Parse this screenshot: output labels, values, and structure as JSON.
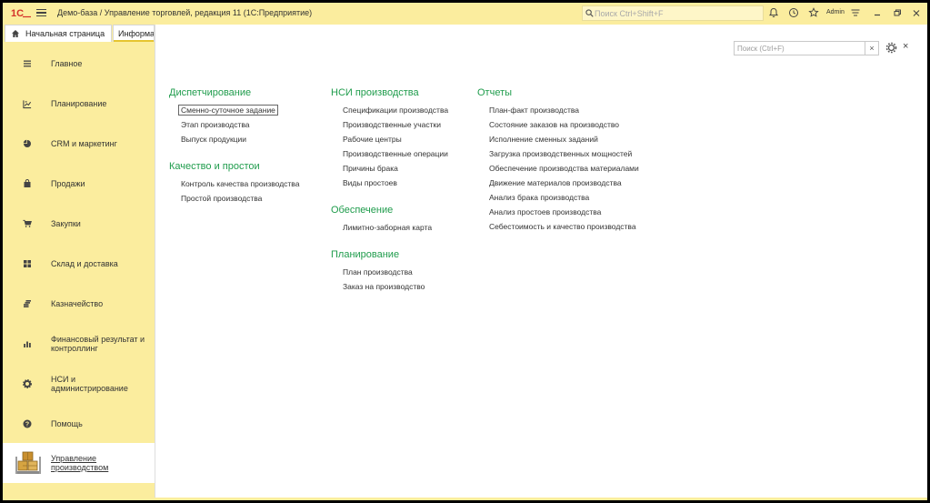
{
  "window": {
    "title": "Демо-база / Управление торговлей, редакция 11  (1С:Предприятие)",
    "search_placeholder": "Поиск Ctrl+Shift+F",
    "user": "Admin"
  },
  "tabs": [
    {
      "label": "Начальная страница"
    },
    {
      "label": "Информа"
    }
  ],
  "sidebar": {
    "items": [
      {
        "label": "Главное",
        "icon": "menu-lines-icon"
      },
      {
        "label": "Планирование",
        "icon": "planning-chart-icon"
      },
      {
        "label": "CRM и маркетинг",
        "icon": "pie-chart-icon"
      },
      {
        "label": "Продажи",
        "icon": "bag-icon"
      },
      {
        "label": "Закупки",
        "icon": "cart-icon"
      },
      {
        "label": "Склад и доставка",
        "icon": "warehouse-grid-icon"
      },
      {
        "label": "Казначейство",
        "icon": "coins-stack-icon"
      },
      {
        "label": "Финансовый результат и контроллинг",
        "icon": "bar-chart-icon"
      },
      {
        "label": "НСИ и администрирование",
        "icon": "gear-icon"
      },
      {
        "label": "Помощь",
        "icon": "help-icon"
      },
      {
        "label": "Управление производством",
        "icon": "production-boxes-icon"
      }
    ]
  },
  "form": {
    "search_placeholder": "Поиск (Ctrl+F)",
    "clear_label": "×",
    "close_label": "×"
  },
  "columns": [
    {
      "groups": [
        {
          "title": "Диспетчирование",
          "links": [
            "Сменно-суточное задание",
            "Этап производства",
            "Выпуск продукции"
          ]
        },
        {
          "title": "Качество и простои",
          "links": [
            "Контроль качества производства",
            "Простой производства"
          ]
        }
      ]
    },
    {
      "groups": [
        {
          "title": "НСИ производства",
          "links": [
            "Спецификации производства",
            "Производственные участки",
            "Рабочие центры",
            "Производственные операции",
            "Причины брака",
            "Виды простоев"
          ]
        },
        {
          "title": "Обеспечение",
          "links": [
            "Лимитно-заборная карта"
          ]
        },
        {
          "title": "Планирование",
          "links": [
            "План производства",
            "Заказ на производство"
          ]
        }
      ]
    },
    {
      "groups": [
        {
          "title": "Отчеты",
          "links": [
            "План-факт производства",
            "Состояние заказов на производство",
            "Исполнение сменных заданий",
            "Загрузка производственных мощностей",
            "Обеспечение производства материалами",
            "Движение материалов производства",
            "Анализ брака производства",
            "Анализ простоев производства",
            "Себестоимость и качество производства"
          ]
        }
      ]
    }
  ],
  "colors": {
    "panel_bg": "#fbed9e",
    "group_title": "#1f9c4c",
    "brand_red": "#d4322a"
  }
}
